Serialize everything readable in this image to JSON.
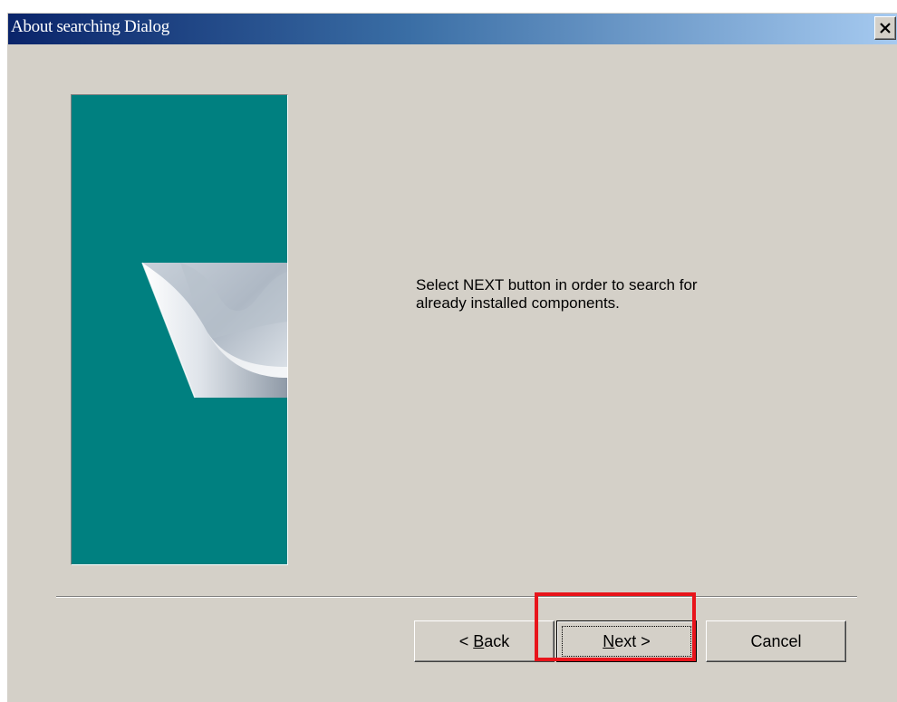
{
  "window": {
    "title": "About searching Dialog",
    "close_icon": "close-icon"
  },
  "banner": {
    "background_color": "#008080",
    "image": "page-curl-graphic"
  },
  "message": {
    "line1": "Select NEXT button in order to search for",
    "line2": "already installed components."
  },
  "buttons": {
    "back": {
      "prefix": "< ",
      "mnemonic": "B",
      "rest": "ack"
    },
    "next": {
      "mnemonic": "N",
      "rest": "ext >"
    },
    "cancel": {
      "label": "Cancel"
    }
  },
  "colors": {
    "dialog_face": "#d4d0c8",
    "titlebar_start": "#0a246a",
    "titlebar_end": "#a6caf0",
    "highlight": "#e8141b"
  }
}
